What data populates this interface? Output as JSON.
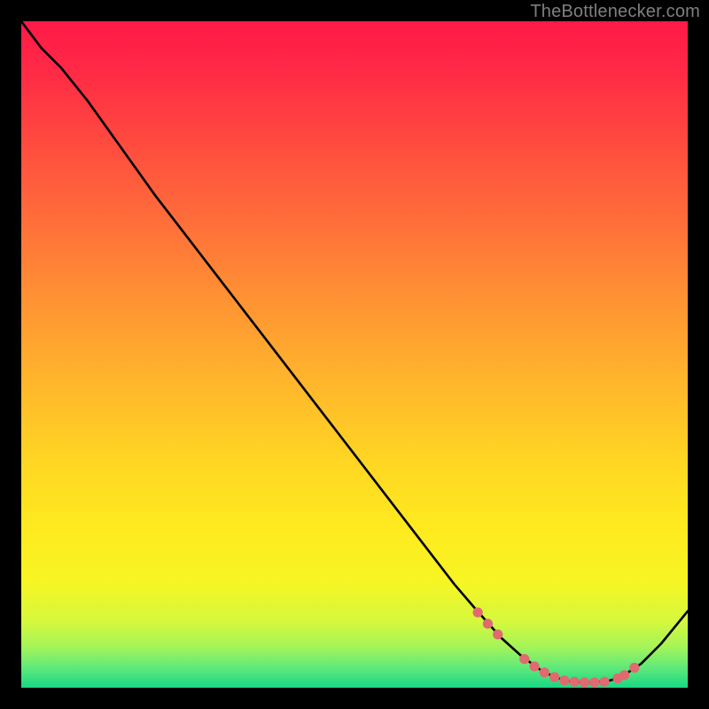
{
  "attribution": "TheBottlenecker.com",
  "gradient_stops": [
    {
      "offset": 0.0,
      "color": "#ff1a47"
    },
    {
      "offset": 0.08,
      "color": "#ff2b45"
    },
    {
      "offset": 0.18,
      "color": "#ff4a3f"
    },
    {
      "offset": 0.3,
      "color": "#ff6e3a"
    },
    {
      "offset": 0.42,
      "color": "#ff9333"
    },
    {
      "offset": 0.55,
      "color": "#ffb82b"
    },
    {
      "offset": 0.66,
      "color": "#ffd623"
    },
    {
      "offset": 0.76,
      "color": "#feea1f"
    },
    {
      "offset": 0.84,
      "color": "#f7f523"
    },
    {
      "offset": 0.9,
      "color": "#d6f83d"
    },
    {
      "offset": 0.94,
      "color": "#a2f45a"
    },
    {
      "offset": 0.97,
      "color": "#5fe97a"
    },
    {
      "offset": 1.0,
      "color": "#18d884"
    }
  ],
  "chart_data": {
    "type": "line",
    "title": "",
    "xlabel": "",
    "ylabel": "",
    "xlim": [
      0,
      100
    ],
    "ylim": [
      0,
      100
    ],
    "series": [
      {
        "name": "curve",
        "x": [
          0,
          3,
          6,
          10,
          15,
          20,
          25,
          30,
          35,
          40,
          45,
          50,
          55,
          60,
          65,
          68,
          72,
          75,
          78,
          80,
          82,
          84,
          86,
          88,
          90,
          93,
          96,
          100
        ],
        "y": [
          100,
          96,
          93,
          88,
          81,
          74,
          67.5,
          61,
          54.5,
          48,
          41.5,
          35,
          28.5,
          22,
          15.5,
          12,
          7.5,
          4.8,
          2.6,
          1.6,
          1.0,
          0.8,
          0.8,
          1.0,
          1.6,
          3.6,
          6.6,
          11.5
        ]
      }
    ],
    "markers": {
      "name": "highlight-points",
      "color": "#e06a6f",
      "x": [
        68.5,
        70.0,
        71.5,
        75.5,
        77.0,
        78.5,
        80.0,
        81.5,
        83.0,
        84.5,
        86.0,
        87.5,
        89.5,
        90.5,
        92.0
      ],
      "y": [
        11.3,
        9.6,
        8.0,
        4.3,
        3.2,
        2.3,
        1.6,
        1.1,
        0.9,
        0.8,
        0.8,
        0.9,
        1.4,
        1.9,
        3.0
      ]
    }
  }
}
